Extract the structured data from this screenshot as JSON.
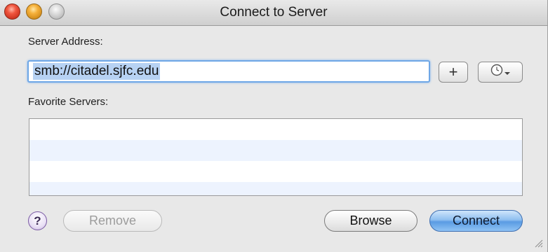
{
  "window": {
    "title": "Connect to Server"
  },
  "form": {
    "server_address_label": "Server Address:",
    "server_address_value": "smb://citadel.sjfc.edu",
    "add_button_label": "+",
    "recent_button_icon": "clock-icon",
    "favorites_label": "Favorite Servers:",
    "favorites": []
  },
  "buttons": {
    "help_label": "?",
    "remove_label": "Remove",
    "browse_label": "Browse",
    "connect_label": "Connect"
  },
  "colors": {
    "focus_ring": "#6fa7e6",
    "selection": "#b7d2f3",
    "default_button": "#5a9be3",
    "list_alt_row": "#edf3fe"
  }
}
